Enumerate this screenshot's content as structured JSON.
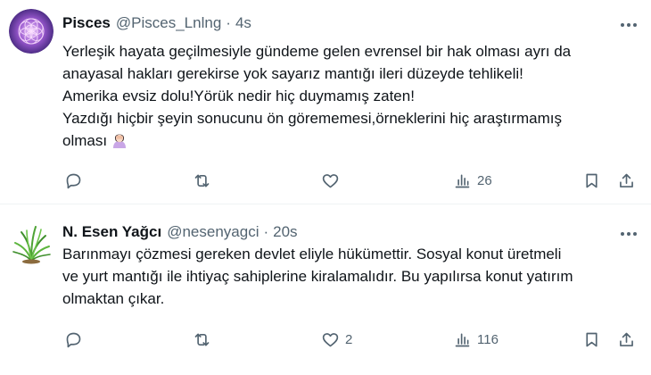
{
  "tweets": [
    {
      "display_name": "Pisces",
      "handle": "@Pisces_Lnlng",
      "separator": "·",
      "time": "4s",
      "lines": [
        "Yerleşik hayata geçilmesiyle gündeme gelen evrensel bir hak olması ayrı da",
        "anayasal hakları gerekirse yok sayarız mantığı ileri düzeyde tehlikeli!",
        "Amerika evsiz dolu!Yörük nedir hiç duymamış zaten!",
        "Yazdığı hiçbir şeyin sonucunu ön görememesi,örneklerini hiç araştırmamış",
        "olması"
      ],
      "emoji": "woman-facepalming-emoji",
      "reply_count": "",
      "retweet_count": "",
      "like_count": "",
      "view_count": "26"
    },
    {
      "display_name": "N. Esen Yağcı",
      "handle": "@nesenyagci",
      "separator": "·",
      "time": "20s",
      "lines": [
        "Barınmayı çözmesi gereken devlet eliyle hükümettir. Sosyal konut üretmeli",
        "ve yurt mantığı ile ihtiyaç sahiplerine kiralamalıdır. Bu yapılırsa konut yatırım",
        "olmaktan çıkar."
      ],
      "reply_count": "",
      "retweet_count": "",
      "like_count": "2",
      "view_count": "116"
    }
  ],
  "icons": {
    "reply": "reply-icon",
    "retweet": "retweet-icon",
    "like": "heart-icon",
    "views": "views-icon",
    "bookmark": "bookmark-icon",
    "share": "share-icon",
    "more": "more-icon"
  },
  "colors": {
    "text": "#0f1419",
    "secondary": "#536471",
    "divider": "#eff3f4"
  }
}
